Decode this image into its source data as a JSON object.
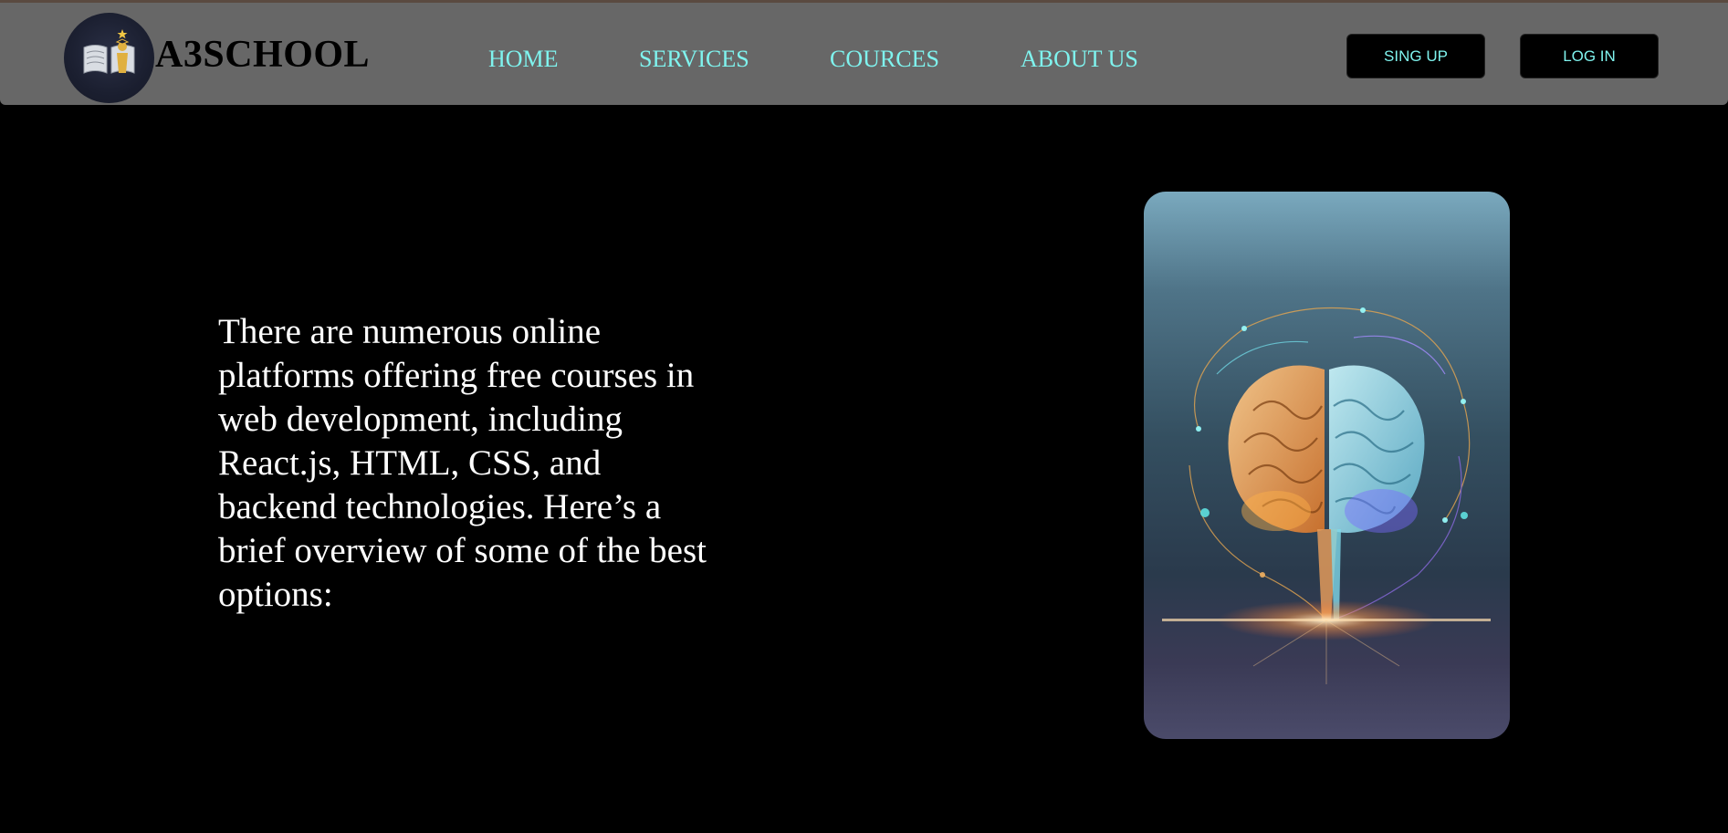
{
  "brand": {
    "name": "A3SCHOOL",
    "logo_icon": "book-graduate-icon"
  },
  "nav": {
    "items": [
      {
        "label": "HOME"
      },
      {
        "label": "SERVICES"
      },
      {
        "label": "COURCES"
      },
      {
        "label": "ABOUT US"
      }
    ],
    "link_color": "#7ff3ee"
  },
  "actions": {
    "signup_label": "SING UP",
    "login_label": "LOG IN"
  },
  "hero": {
    "text": "There are numerous online platforms offering free courses in web development, including React.js, HTML, CSS, and backend technologies. Here’s a brief overview of some of the best options:",
    "image_icon": "glowing-brain-illustration"
  },
  "colors": {
    "navbar_bg": "#676767",
    "page_bg": "#000000",
    "accent": "#7ff3ee"
  }
}
